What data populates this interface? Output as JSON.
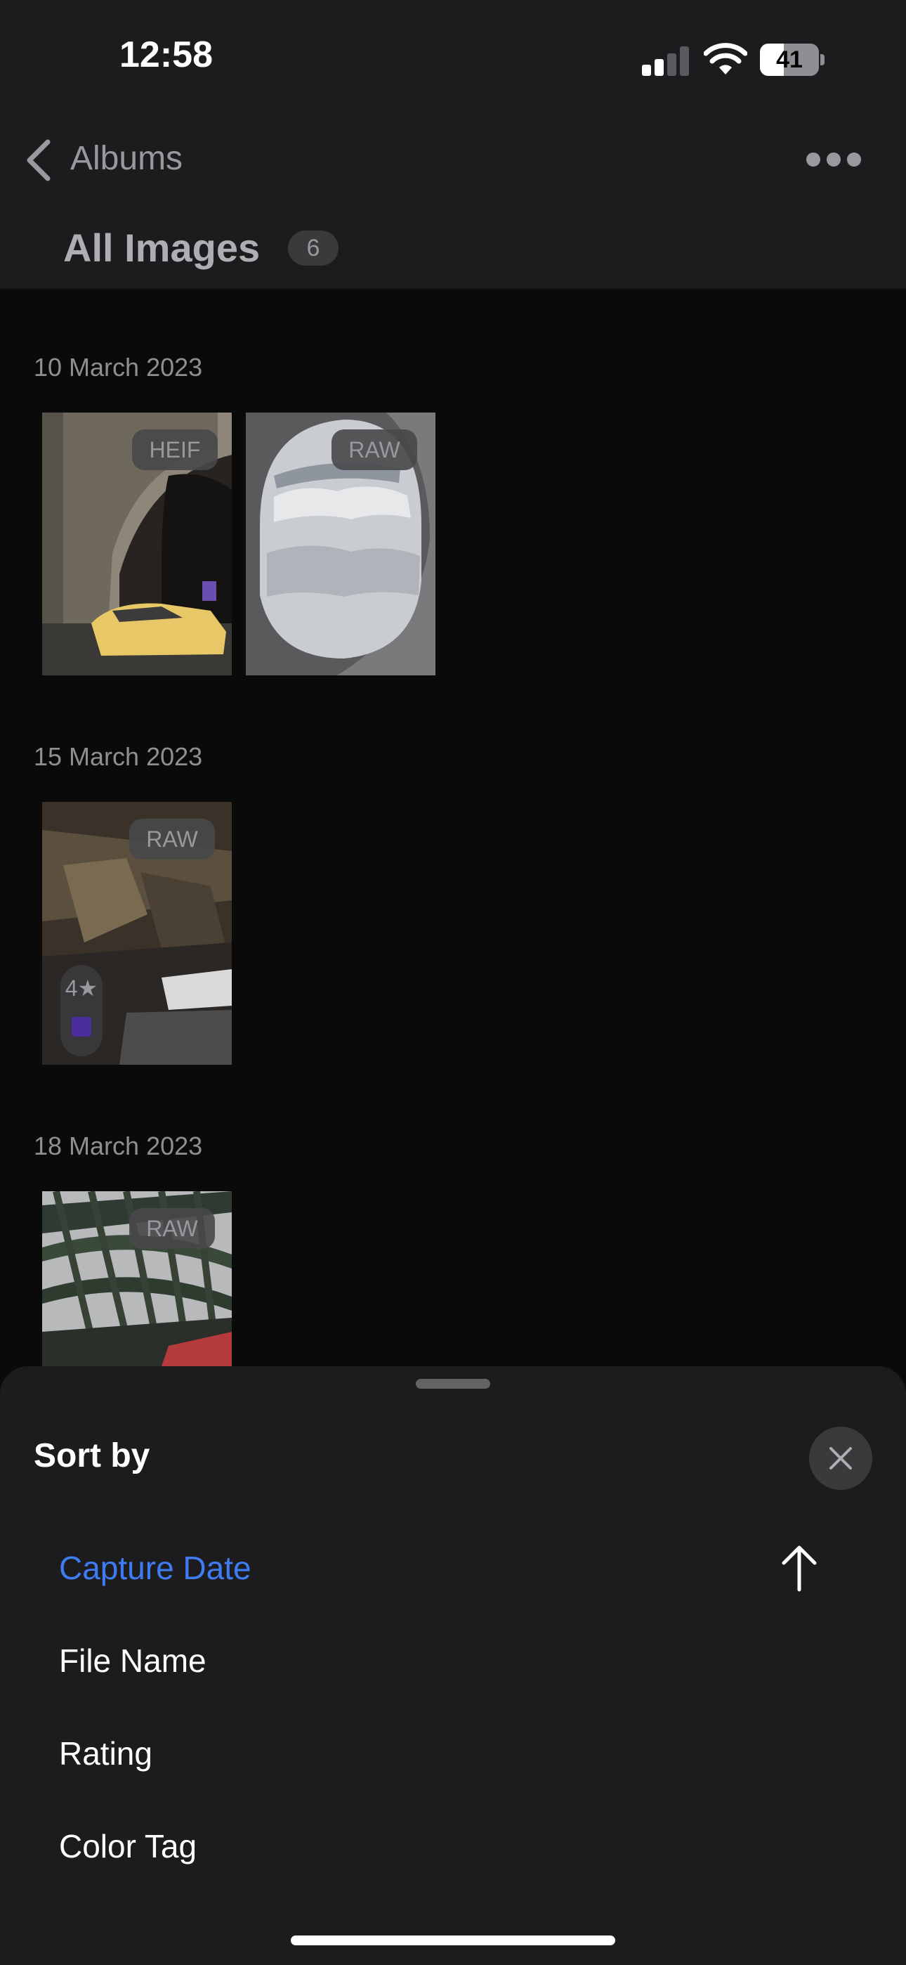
{
  "status_bar": {
    "time": "12:58",
    "battery": "41",
    "battery_level": 0.41,
    "signal_bars_active": 2
  },
  "nav": {
    "back_label": "Albums",
    "title": "All Images",
    "count": "6"
  },
  "groups": [
    {
      "date": "10 March 2023",
      "items": [
        {
          "type": "HEIF",
          "subject": "bridge-arch-with-taxi"
        },
        {
          "type": "RAW",
          "subject": "airplane-window-clouds"
        }
      ]
    },
    {
      "date": "15 March 2023",
      "items": [
        {
          "type": "RAW",
          "subject": "blurred-motion",
          "rating": "4",
          "color_tag": "#4b2d9e"
        }
      ]
    },
    {
      "date": "18 March 2023",
      "items": [
        {
          "type": "RAW",
          "subject": "steel-bridge-truss"
        }
      ]
    }
  ],
  "sort_sheet": {
    "title": "Sort by",
    "options": [
      {
        "label": "Capture Date",
        "selected": true
      },
      {
        "label": "File Name",
        "selected": false
      },
      {
        "label": "Rating",
        "selected": false
      },
      {
        "label": "Color Tag",
        "selected": false
      }
    ],
    "direction": "ascending"
  },
  "colors": {
    "accent": "#3f7cf2",
    "sheet_bg": "#1c1c1e",
    "page_bg": "#0a0a0b"
  }
}
